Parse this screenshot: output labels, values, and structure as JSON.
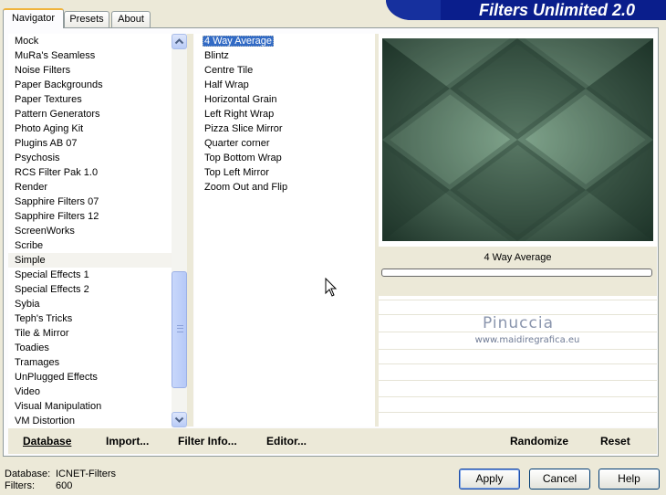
{
  "tabs": [
    {
      "label": "Navigator"
    },
    {
      "label": "Presets"
    },
    {
      "label": "About"
    }
  ],
  "banner": {
    "title": "Filters Unlimited 2.0"
  },
  "categories": [
    "Mock",
    "MuRa's Seamless",
    "Noise Filters",
    "Paper Backgrounds",
    "Paper Textures",
    "Pattern Generators",
    "Photo Aging Kit",
    "Plugins AB 07",
    "Psychosis",
    "RCS Filter Pak 1.0",
    "Render",
    "Sapphire Filters 07",
    "Sapphire Filters 12",
    "ScreenWorks",
    "Scribe",
    "Simple",
    "Special Effects 1",
    "Special Effects 2",
    "Sybia",
    "Teph's Tricks",
    "Tile & Mirror",
    "Toadies",
    "Tramages",
    "UnPlugged Effects",
    "Video",
    "Visual Manipulation",
    "VM Distortion"
  ],
  "selected_category": "Simple",
  "filters": [
    "4 Way Average",
    "Blintz",
    "Centre Tile",
    "Half Wrap",
    "Horizontal Grain",
    "Left Right Wrap",
    "Pizza Slice Mirror",
    "Quarter corner",
    "Top Bottom Wrap",
    "Top Left Mirror",
    "Zoom Out and Flip"
  ],
  "selected_filter": "4 Way Average",
  "preview": {
    "caption": "4 Way Average",
    "progress": 0
  },
  "watermark": {
    "name": "Pinuccia",
    "url": "www.maidiregrafica.eu"
  },
  "toolbar": {
    "database": "Database",
    "import": "Import...",
    "filter_info": "Filter Info...",
    "editor": "Editor...",
    "randomize": "Randomize",
    "reset": "Reset"
  },
  "footer": {
    "database_label": "Database:",
    "database_value": "ICNET-Filters",
    "filters_label": "Filters:",
    "filters_value": "600"
  },
  "buttons": {
    "apply": "Apply",
    "cancel": "Cancel",
    "help": "Help"
  },
  "icons": {
    "scroll_up": "scroll-up-arrow-icon",
    "scroll_down": "scroll-down-arrow-icon",
    "cursor": "mouse-pointer-icon"
  },
  "colors": {
    "selection": "#316ac5",
    "banner": "#0a1e8c",
    "preview_base": "#3f5a4b"
  }
}
